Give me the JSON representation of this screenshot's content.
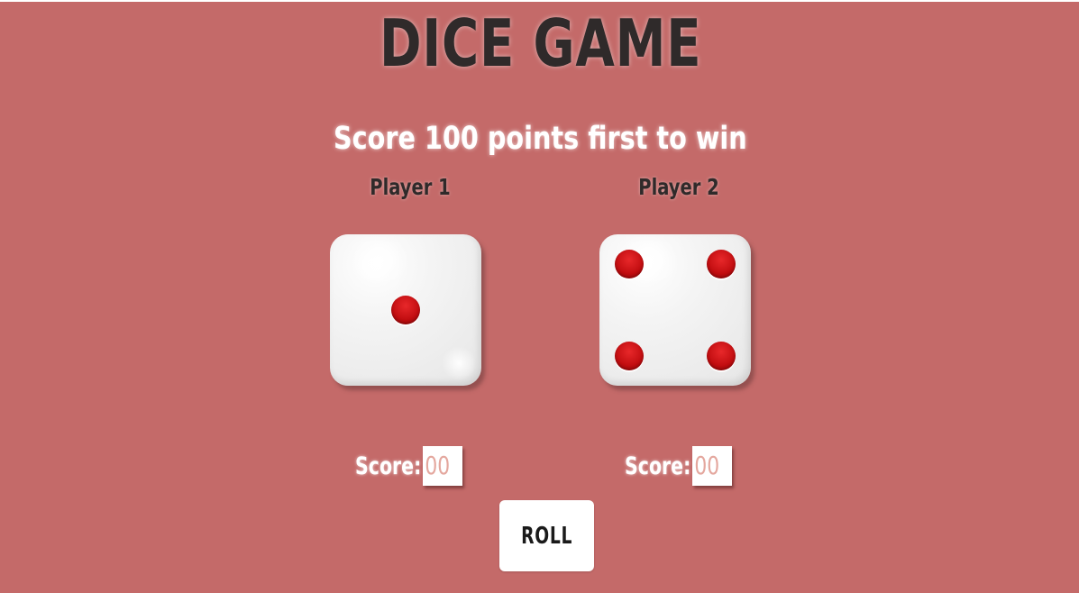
{
  "game": {
    "title": "DICE GAME",
    "subtitle": "Score 100 points first to win",
    "colors": {
      "background": "#c46a69",
      "pip": "#c10d10",
      "die_face": "#f4f4f4",
      "score_text": "#e4a79e"
    }
  },
  "players": [
    {
      "label": "Player 1",
      "die_value": 1,
      "score_label": "Score:",
      "score": "00"
    },
    {
      "label": "Player 2",
      "die_value": 4,
      "score_label": "Score:",
      "score": "00"
    }
  ],
  "controls": {
    "roll_label": "ROLL"
  }
}
